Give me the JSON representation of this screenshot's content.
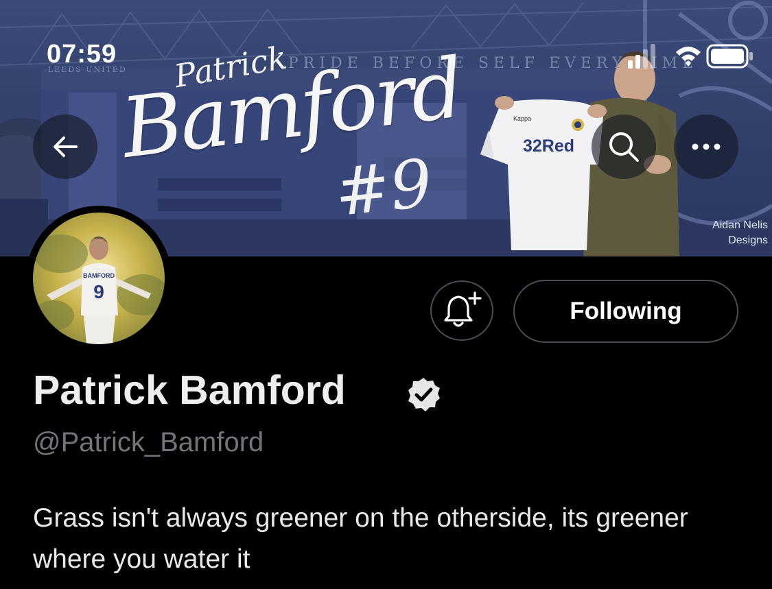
{
  "status_bar": {
    "time": "07:59",
    "icons": [
      "cellular-signal-icon",
      "wifi-icon",
      "battery-icon"
    ]
  },
  "header": {
    "back_icon": "arrow-left-icon",
    "search_icon": "search-icon",
    "more_icon": "more-horizontal-icon",
    "banner": {
      "stadium_sign": "PRIDE BEFORE SELF EVERY TIME",
      "club_text": "LEEDS UNITED",
      "name_small": "Patrick",
      "name_large": "Bamford",
      "number": "#9",
      "shirt_brand": "Kappa",
      "shirt_sponsor": "32Red",
      "credit_line1": "Aidan Nelis",
      "credit_line2": "Designs"
    }
  },
  "profile": {
    "display_name": "Patrick Bamford",
    "verified": true,
    "handle": "@Patrick_Bamford",
    "bio": "Grass isn't always greener on the otherside, its greener where you water it",
    "avatar_text": "BAMFORD",
    "avatar_number": "9"
  },
  "actions": {
    "notify_icon": "bell-plus-icon",
    "following_label": "Following"
  },
  "colors": {
    "background": "#000000",
    "banner_blue": "#33416c",
    "handle_gray": "#71767b",
    "button_border": "#4a4f55"
  }
}
